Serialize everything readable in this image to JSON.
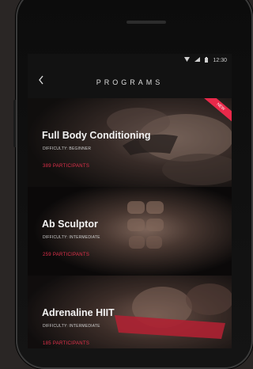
{
  "status_bar": {
    "time": "12:30"
  },
  "header": {
    "back_icon": "chevron-left-icon",
    "title": "PROGRAMS"
  },
  "programs": [
    {
      "title": "Full Body Conditioning",
      "difficulty": "DIFFICULTY: BEGINNER",
      "participants": "389 PARTICIPANTS",
      "badge": "NEW"
    },
    {
      "title": "Ab Sculptor",
      "difficulty": "DIFFICULTY: INTERMEDIATE",
      "participants": "259 PARTICIPANTS"
    },
    {
      "title": "Adrenaline HIIT",
      "difficulty": "DIFFICULTY: INTERMEDIATE",
      "participants": "185 PARTICIPANTS"
    }
  ],
  "colors": {
    "accent": "#e2304b",
    "background": "#121212"
  }
}
